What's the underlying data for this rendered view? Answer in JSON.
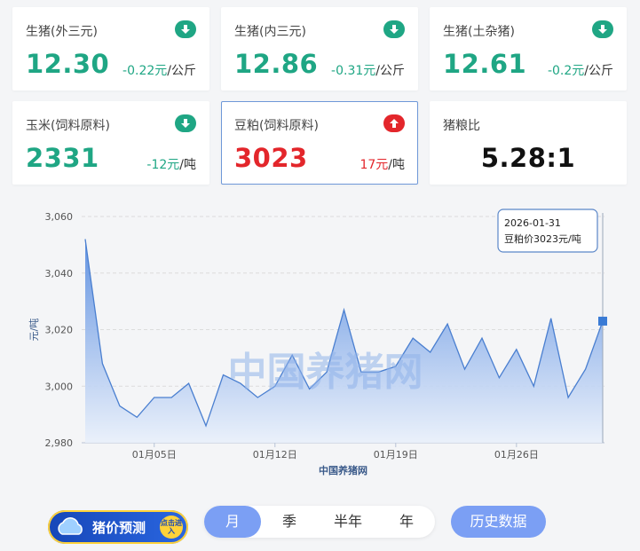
{
  "cards": [
    {
      "name": "生猪(外三元)",
      "value": "12.30",
      "change": "-0.22元",
      "unit": "/公斤",
      "trend": "down"
    },
    {
      "name": "生猪(内三元)",
      "value": "12.86",
      "change": "-0.31元",
      "unit": "/公斤",
      "trend": "down"
    },
    {
      "name": "生猪(土杂猪)",
      "value": "12.61",
      "change": "-0.2元",
      "unit": "/公斤",
      "trend": "down"
    },
    {
      "name": "玉米(饲料原料)",
      "value": "2331",
      "change": "-12元",
      "unit": "/吨",
      "trend": "down"
    },
    {
      "name": "豆粕(饲料原料)",
      "value": "3023",
      "change": "17元",
      "unit": "/吨",
      "trend": "up",
      "selected": true
    },
    {
      "name": "猪粮比",
      "value": "5.28:1"
    }
  ],
  "colors": {
    "down": "#1fa684",
    "up": "#e3262b",
    "accent": "#7b9ff4",
    "series": "#4a7fd0"
  },
  "chart_data": {
    "type": "area",
    "ylabel": "元/吨",
    "xlabel": "中国养猪网",
    "watermark": "中国养猪网",
    "ylim": [
      2980,
      3060
    ],
    "yticks": [
      "2,980",
      "3,000",
      "3,020",
      "3,040",
      "3,060"
    ],
    "ytick_values": [
      2980,
      3000,
      3020,
      3040,
      3060
    ],
    "xticks": [
      "01月05日",
      "01月12日",
      "01月19日",
      "01月26日"
    ],
    "xtick_dates": [
      "2026-01-05",
      "2026-01-12",
      "2026-01-19",
      "2026-01-26"
    ],
    "x": [
      "2026-01-01",
      "2026-01-02",
      "2026-01-03",
      "2026-01-04",
      "2026-01-05",
      "2026-01-06",
      "2026-01-07",
      "2026-01-08",
      "2026-01-09",
      "2026-01-10",
      "2026-01-11",
      "2026-01-12",
      "2026-01-13",
      "2026-01-14",
      "2026-01-15",
      "2026-01-16",
      "2026-01-17",
      "2026-01-18",
      "2026-01-19",
      "2026-01-20",
      "2026-01-21",
      "2026-01-22",
      "2026-01-23",
      "2026-01-24",
      "2026-01-25",
      "2026-01-26",
      "2026-01-27",
      "2026-01-28",
      "2026-01-29",
      "2026-01-30",
      "2026-01-31"
    ],
    "series": [
      {
        "values": [
          3052,
          3008,
          2993,
          2989,
          2996,
          2996,
          3001,
          2986,
          3004,
          3001,
          2996,
          3000,
          3011,
          2999,
          3005,
          3027,
          3005,
          3005,
          3007,
          3017,
          3012,
          3022,
          3006,
          3017,
          3003,
          3013,
          3000,
          3024,
          2996,
          3006,
          3023
        ]
      }
    ],
    "tooltip": {
      "date": "2026-01-31",
      "text": "豆粕价3023元/吨"
    }
  },
  "periods": [
    "月",
    "季",
    "半年",
    "年"
  ],
  "active_period": "月",
  "history_button": "历史数据",
  "forecast": {
    "label": "猪价预测",
    "badge": "点击进入"
  }
}
